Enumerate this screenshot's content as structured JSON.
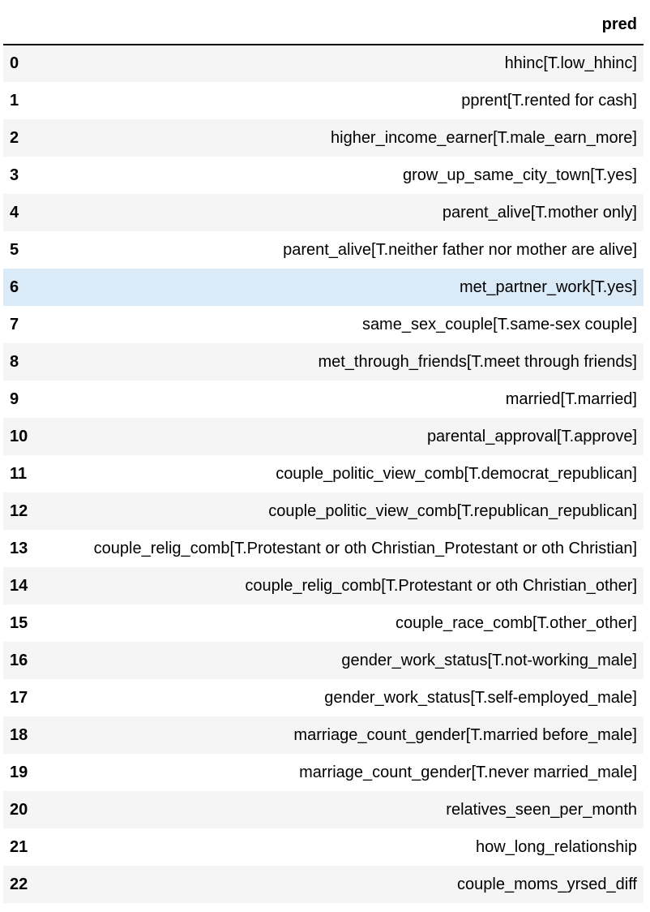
{
  "table": {
    "index_header": "",
    "column_header": "pred",
    "highlight_color": "#dbeaf7",
    "stripe_color": "#f5f5f5",
    "highlighted_row_index": "6",
    "rows": [
      {
        "index": "0",
        "pred": "hhinc[T.low_hhinc]"
      },
      {
        "index": "1",
        "pred": "pprent[T.rented for cash]"
      },
      {
        "index": "2",
        "pred": "higher_income_earner[T.male_earn_more]"
      },
      {
        "index": "3",
        "pred": "grow_up_same_city_town[T.yes]"
      },
      {
        "index": "4",
        "pred": "parent_alive[T.mother only]"
      },
      {
        "index": "5",
        "pred": "parent_alive[T.neither father nor mother are alive]"
      },
      {
        "index": "6",
        "pred": "met_partner_work[T.yes]"
      },
      {
        "index": "7",
        "pred": "same_sex_couple[T.same-sex couple]"
      },
      {
        "index": "8",
        "pred": "met_through_friends[T.meet through friends]"
      },
      {
        "index": "9",
        "pred": "married[T.married]"
      },
      {
        "index": "10",
        "pred": "parental_approval[T.approve]"
      },
      {
        "index": "11",
        "pred": "couple_politic_view_comb[T.democrat_republican]"
      },
      {
        "index": "12",
        "pred": "couple_politic_view_comb[T.republican_republican]"
      },
      {
        "index": "13",
        "pred": "couple_relig_comb[T.Protestant or oth Christian_Protestant or oth Christian]"
      },
      {
        "index": "14",
        "pred": "couple_relig_comb[T.Protestant or oth Christian_other]"
      },
      {
        "index": "15",
        "pred": "couple_race_comb[T.other_other]"
      },
      {
        "index": "16",
        "pred": "gender_work_status[T.not-working_male]"
      },
      {
        "index": "17",
        "pred": "gender_work_status[T.self-employed_male]"
      },
      {
        "index": "18",
        "pred": "marriage_count_gender[T.married before_male]"
      },
      {
        "index": "19",
        "pred": "marriage_count_gender[T.never married_male]"
      },
      {
        "index": "20",
        "pred": "relatives_seen_per_month"
      },
      {
        "index": "21",
        "pred": "how_long_relationship"
      },
      {
        "index": "22",
        "pred": "couple_moms_yrsed_diff"
      }
    ]
  }
}
